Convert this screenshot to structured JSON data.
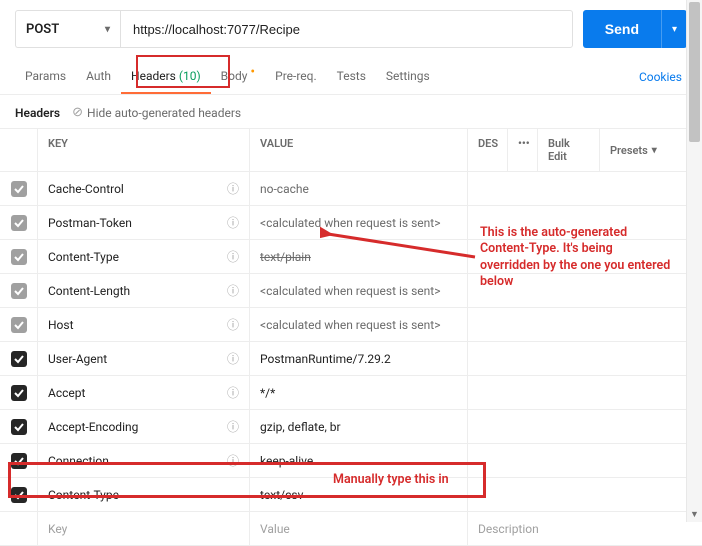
{
  "request": {
    "method": "POST",
    "url": "https://localhost:7077/Recipe",
    "send_label": "Send"
  },
  "tabs": {
    "params": "Params",
    "auth": "Auth",
    "headers_label": "Headers",
    "headers_count": "(10)",
    "body": "Body",
    "prereq": "Pre-req.",
    "tests": "Tests",
    "settings": "Settings",
    "cookies": "Cookies"
  },
  "subbar": {
    "section": "Headers",
    "hide_auto": "Hide auto-generated headers"
  },
  "columns": {
    "key": "KEY",
    "value": "VALUE",
    "desc": "DES",
    "bulk": "Bulk Edit",
    "presets": "Presets"
  },
  "rows": [
    {
      "key": "Cache-Control",
      "value": "no-cache",
      "auto": true,
      "checked": "grey",
      "info": true
    },
    {
      "key": "Postman-Token",
      "value": "<calculated when request is sent>",
      "auto": true,
      "checked": "grey",
      "info": true
    },
    {
      "key": "Content-Type",
      "value": "text/plain",
      "auto": true,
      "checked": "grey",
      "info": true,
      "strike": true
    },
    {
      "key": "Content-Length",
      "value": "<calculated when request is sent>",
      "auto": true,
      "checked": "grey",
      "info": true
    },
    {
      "key": "Host",
      "value": "<calculated when request is sent>",
      "auto": true,
      "checked": "grey",
      "info": true
    },
    {
      "key": "User-Agent",
      "value": "PostmanRuntime/7.29.2",
      "auto": false,
      "checked": "dark",
      "info": true
    },
    {
      "key": "Accept",
      "value": "*/*",
      "auto": false,
      "checked": "dark",
      "info": true
    },
    {
      "key": "Accept-Encoding",
      "value": "gzip, deflate, br",
      "auto": false,
      "checked": "dark",
      "info": true
    },
    {
      "key": "Connection",
      "value": "keep-alive",
      "auto": false,
      "checked": "dark",
      "info": true
    },
    {
      "key": "Content-Type",
      "value": "text/csv",
      "auto": false,
      "checked": "dark",
      "info": false
    }
  ],
  "placeholder": {
    "key": "Key",
    "value": "Value",
    "desc": "Description"
  },
  "annotations": {
    "main": "This is the auto-generated Content-Type. It's being overridden by the one you entered below",
    "manual": "Manually type this in"
  }
}
